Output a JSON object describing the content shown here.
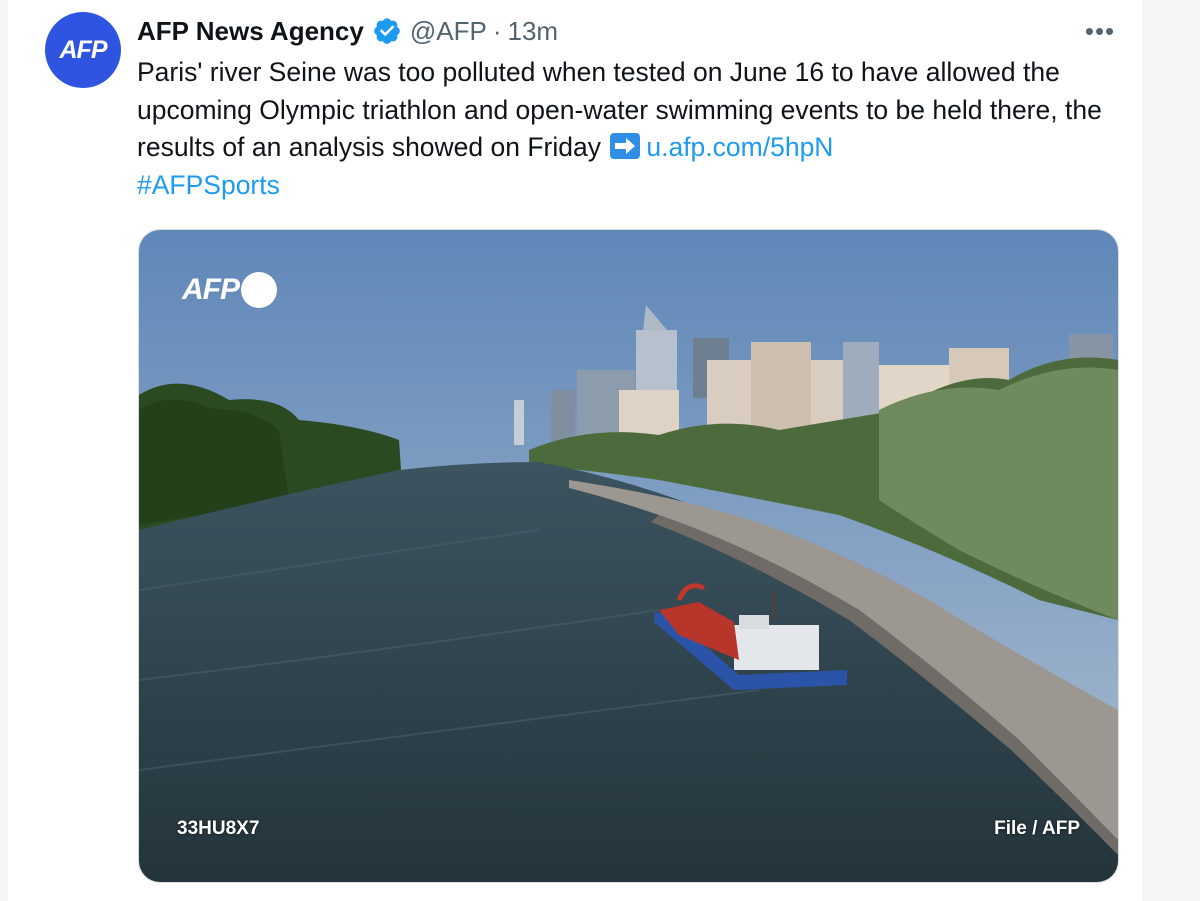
{
  "tweet": {
    "avatar_text": "AFP",
    "author_name": "AFP News Agency",
    "handle": "@AFP",
    "separator": "·",
    "time": "13m",
    "more_label": "•••",
    "body_text": "Paris' river Seine was too polluted when tested on June 16 to have allowed the upcoming Olympic triathlon and open-water swimming events to be held there, the results of an analysis showed on Friday",
    "link_text": "u.afp.com/5hpN",
    "hashtag": "#AFPSports"
  },
  "media": {
    "watermark": "AFP",
    "photo_id": "33HU8X7",
    "credit": "File / AFP"
  },
  "colors": {
    "avatar_bg": "#2f55e0",
    "verified": "#1d9bf0",
    "link": "#1d9bf0",
    "text": "#0f1419",
    "muted": "#536471"
  },
  "icons": {
    "verified": "verified-badge-icon",
    "more": "more-options-icon",
    "arrow": "right-arrow-emoji-icon"
  }
}
